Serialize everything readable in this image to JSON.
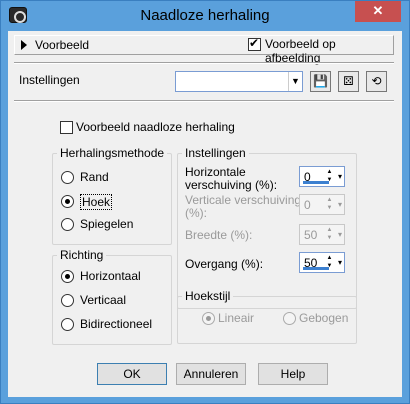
{
  "window": {
    "title": "Naadloze herhaling"
  },
  "preview_bar": {
    "voorbeeld_label": "Voorbeeld",
    "preview_on_image_label": "Voorbeeld op afbeelding",
    "preview_on_image_checked": true
  },
  "presets": {
    "label": "Instellingen",
    "combo_value": ""
  },
  "preview_seamless": {
    "label": "Voorbeeld naadloze herhaling",
    "checked": false
  },
  "method": {
    "title": "Herhalingsmethode",
    "options": [
      "Rand",
      "Hoek",
      "Spiegelen"
    ],
    "selected": "Hoek"
  },
  "settings": {
    "title": "Instellingen",
    "horizontal_offset": {
      "label_line1": "Horizontale",
      "label_line2": "verschuiving (%):",
      "value": "0"
    },
    "vertical_offset": {
      "label_line1": "Verticale verschuiving",
      "label_line2": "(%):",
      "value": "0"
    },
    "width": {
      "label": "Breedte (%):",
      "value": "50"
    },
    "transition": {
      "label": "Overgang (%):",
      "value": "50"
    }
  },
  "direction": {
    "title": "Richting",
    "options": [
      "Horizontaal",
      "Verticaal",
      "Bidirectioneel"
    ],
    "selected": "Horizontaal"
  },
  "corner_style": {
    "title": "Hoekstijl",
    "options": [
      "Lineair",
      "Gebogen"
    ],
    "selected": "Lineair"
  },
  "buttons": {
    "ok": "OK",
    "cancel": "Annuleren",
    "help": "Help"
  },
  "icons": {
    "app": "camera-icon",
    "close": "close-icon",
    "save": "save-icon",
    "randomize": "dice-icon",
    "reset": "reset-icon"
  }
}
